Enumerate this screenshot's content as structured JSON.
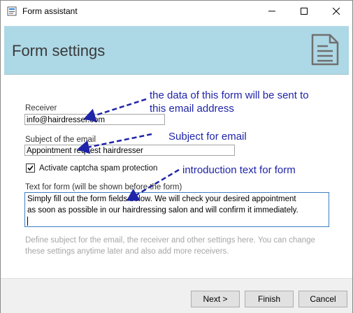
{
  "window": {
    "title": "Form assistant",
    "controls": [
      "minimize-icon",
      "maximize-icon",
      "close-icon"
    ]
  },
  "banner": {
    "title": "Form settings",
    "icon": "document-icon",
    "background": "#add8e6"
  },
  "form": {
    "receiver": {
      "label": "Receiver",
      "value": "info@hairdresser.com"
    },
    "subject": {
      "label": "Subject of the email",
      "value": "Appointment request hairdresser"
    },
    "captcha": {
      "label": "Activate captcha spam protection",
      "checked": true
    },
    "intro": {
      "label": "Text for form (will be shown before the form)",
      "line1": "Simply fill out the form fields below. We will check your desired appointment",
      "line2": "as soon as possible in our hairdressing salon and will confirm it immediately."
    },
    "hint": "Define subject for the email, the receiver and other settings here. You can change these settings anytime later and also add more receivers."
  },
  "buttons": {
    "next": "Next >",
    "finish": "Finish",
    "cancel": "Cancel"
  },
  "annotations": {
    "receiver_note_line1": "the data of this form will be sent to",
    "receiver_note_line2": "this email address",
    "subject_note": "Subject for email",
    "intro_note": "introduction text for form",
    "color": "#1f24a8"
  }
}
